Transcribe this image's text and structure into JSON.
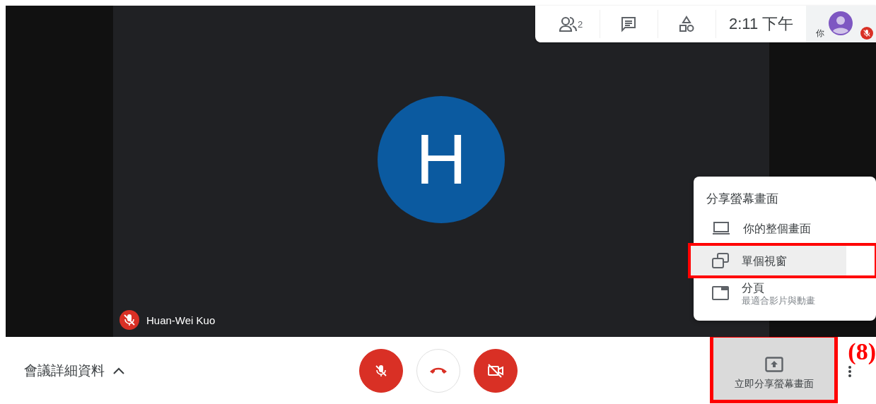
{
  "top_bar": {
    "participants_count": "2",
    "time": "2:11 下午",
    "self_label": "你",
    "self_muted": true
  },
  "tile": {
    "initial": "H",
    "name": "Huan-Wei Kuo",
    "muted": true
  },
  "share_menu": {
    "title": "分享螢幕畫面",
    "items": [
      {
        "kind": "screen",
        "label": "你的整個畫面",
        "selected": false
      },
      {
        "kind": "window",
        "label": "單個視窗",
        "selected": true
      },
      {
        "kind": "tab",
        "label": "分頁",
        "sublabel": "最適合影片與動畫",
        "selected": false
      }
    ]
  },
  "bottom_bar": {
    "details_label": "會議詳細資料",
    "mic_on": false,
    "camera_on": false,
    "present_label": "立即分享螢幕畫面",
    "present_active": true
  },
  "annotation": {
    "label": "(8)"
  }
}
